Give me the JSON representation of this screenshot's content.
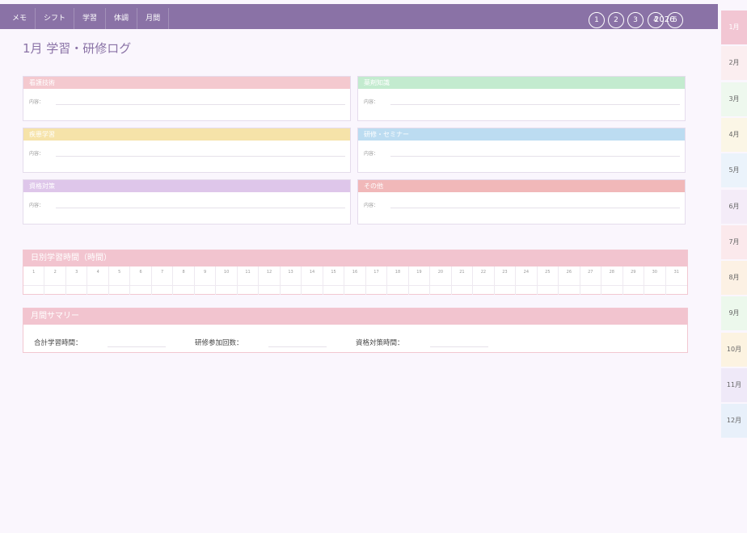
{
  "nav": {
    "tabs": [
      "メモ",
      "シフト",
      "学習",
      "体調",
      "月間"
    ]
  },
  "weeks": {
    "buttons": [
      "1",
      "2",
      "3",
      "4",
      "5"
    ],
    "year": "2026"
  },
  "page": {
    "title": "1月 学習・研修ログ"
  },
  "categories": [
    {
      "name": "看護技術",
      "label": "内容：",
      "color": "#f4c9cf"
    },
    {
      "name": "薬剤知識",
      "label": "内容：",
      "color": "#c3ebcf"
    },
    {
      "name": "疾患学習",
      "label": "内容：",
      "color": "#f6e3a9"
    },
    {
      "name": "研修・セミナー",
      "label": "内容：",
      "color": "#bcdcf1"
    },
    {
      "name": "資格対策",
      "label": "内容：",
      "color": "#dec6ea"
    },
    {
      "name": "その他",
      "label": "内容：",
      "color": "#f1b8b9"
    }
  ],
  "daily": {
    "title": "日別学習時間（時間）",
    "days": [
      "1",
      "2",
      "3",
      "4",
      "5",
      "6",
      "7",
      "8",
      "9",
      "10",
      "11",
      "12",
      "13",
      "14",
      "15",
      "16",
      "17",
      "18",
      "19",
      "20",
      "21",
      "22",
      "23",
      "24",
      "25",
      "26",
      "27",
      "28",
      "29",
      "30",
      "31"
    ]
  },
  "summary": {
    "title": "月間サマリー",
    "items": [
      "合計学習時間：",
      "研修参加回数：",
      "資格対策時間："
    ]
  },
  "months": {
    "items": [
      "1月",
      "2月",
      "3月",
      "4月",
      "5月",
      "6月",
      "7月",
      "8月",
      "9月",
      "10月",
      "11月",
      "12月"
    ],
    "colors": [
      "#f2c6d3",
      "#fbeef0",
      "#eef8ee",
      "#fbf6e6",
      "#ebf3fb",
      "#f4ecf8",
      "#fbe9ec",
      "#fcf1e4",
      "#ecf8ec",
      "#fcf3e1",
      "#efe9f8",
      "#e8f0fa"
    ],
    "selected": 0
  }
}
